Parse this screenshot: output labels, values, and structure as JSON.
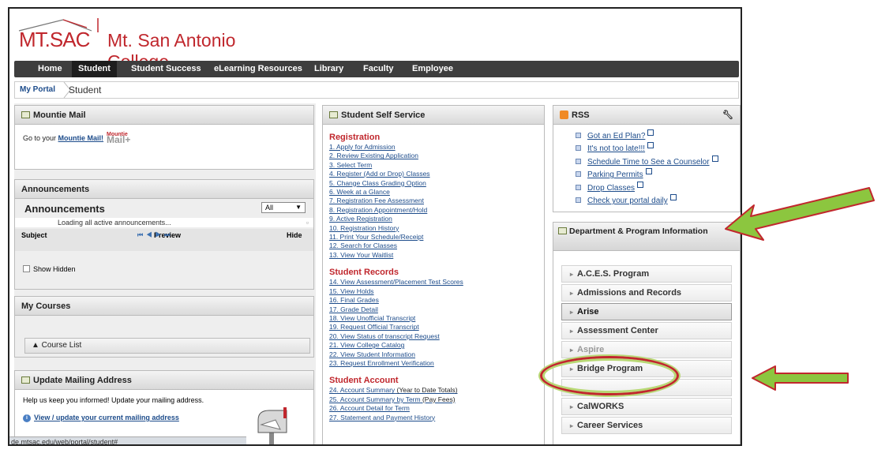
{
  "header": {
    "logo_text": "MT.SAC",
    "college_name": "Mt. San Antonio College"
  },
  "nav": {
    "items": [
      {
        "label": "Home"
      },
      {
        "label": "Student"
      },
      {
        "label": "Student Success"
      },
      {
        "label": "eLearning Resources"
      },
      {
        "label": "Library"
      },
      {
        "label": "Faculty"
      },
      {
        "label": "Employee"
      }
    ],
    "active": "Student"
  },
  "breadcrumb": {
    "root": "My Portal",
    "current": "Student"
  },
  "mountie_mail": {
    "title": "Mountie Mail",
    "prefix": "Go to your",
    "link": "Mountie Mail!",
    "logo_top": "Mountie",
    "logo_main": "Mail+"
  },
  "announcements": {
    "title": "Announcements",
    "heading": "Announcements",
    "filter": "All",
    "loading": "Loading all active announcements...",
    "col_subject": "Subject",
    "col_preview": "Preview",
    "col_hide": "Hide",
    "pager": "⏮ ◀   ▶ ⏭",
    "show_hidden": "Show Hidden"
  },
  "courses": {
    "title": "My Courses",
    "list_label": "▲ Course List"
  },
  "mailing": {
    "title": "Update Mailing Address",
    "text": "Help us keep you informed! Update your mailing address.",
    "link": "View / update your current mailing address"
  },
  "status_url": "de.mtsac.edu/web/portal/student#",
  "self_service": {
    "title": "Student Self Service",
    "sections": [
      {
        "heading": "Registration",
        "links": [
          "1. Apply for Admission",
          "2. Review Existing Application",
          "3. Select Term",
          "4. Register (Add or Drop) Classes",
          "5. Change Class Grading Option",
          "6. Week at a Glance",
          "7. Registration Fee Assessment",
          "8. Registration Appointment/Hold",
          "9. Active Registration",
          "10. Registration History",
          "11. Print Your Schedule/Receipt",
          "12. Search for Classes",
          "13. View Your Waitlist"
        ]
      },
      {
        "heading": "Student Records",
        "links": [
          "14. View Assessment/Placement Test Scores",
          "15. View Holds",
          "16. Final Grades",
          "17. Grade Detail",
          "18. View Unofficial Transcript",
          "19. Request Official Transcript",
          "20. View Status of transcript Request",
          "21. View College Catalog",
          "22. View Student Information",
          "23. Request Enrollment Verification"
        ]
      },
      {
        "heading": "Student Account",
        "links": [
          "24. Account Summary",
          "25. Account Summary by Term",
          "26. Account Detail for Term",
          "27. Statement and Payment History"
        ],
        "notes": [
          "(Year to Date Totals)",
          "(Pay Fees)",
          "",
          ""
        ]
      }
    ]
  },
  "rss": {
    "title": "RSS",
    "items": [
      "Got an Ed Plan?",
      "It's not too late!!!",
      "Schedule Time to See a Counselor",
      "Parking Permits",
      "Drop Classes",
      "Check your portal daily"
    ]
  },
  "dept": {
    "title": "Department & Program Information",
    "items": [
      "A.C.E.S. Program",
      "Admissions and Records",
      "Arise",
      "Assessment Center",
      "Aspire",
      "Bridge Program",
      "",
      "CalWORKS",
      "Career Services"
    ]
  },
  "colors": {
    "brand_red": "#c0272d",
    "nav_bg": "#3e3e3e",
    "link_blue": "#1d4c8b",
    "arrow_green": "#8cc63f",
    "annotation_red": "#c1272d"
  }
}
